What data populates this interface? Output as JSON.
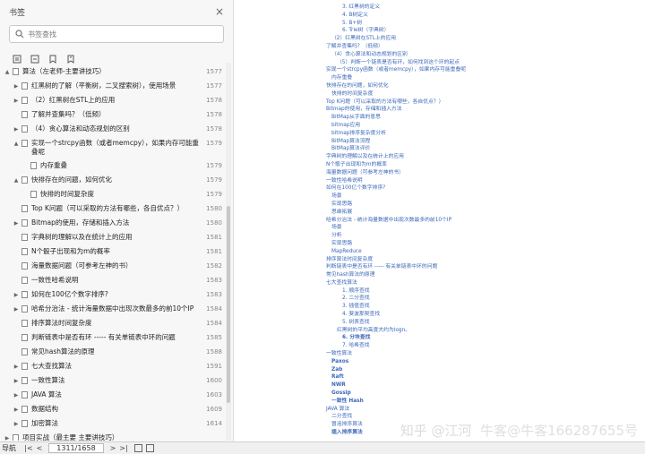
{
  "panel": {
    "title": "书签",
    "close": "×",
    "search_placeholder": "书签查找"
  },
  "bookmarks": [
    {
      "i": 0,
      "t": "▲",
      "text": "算法（左老师-主要讲技巧）",
      "page": "1577"
    },
    {
      "i": 1,
      "t": "▶",
      "text": "红黑树的了解（平衡树，二叉搜索树），使用场景",
      "page": "1577"
    },
    {
      "i": 1,
      "t": "▶",
      "text": "（2）红黑树在STL上的应用",
      "page": "1578"
    },
    {
      "i": 1,
      "t": "",
      "text": "了解并查集吗？（低频）",
      "page": "1578"
    },
    {
      "i": 1,
      "t": "▶",
      "text": "（4）贪心算法和动态规划的区别",
      "page": "1578"
    },
    {
      "i": 1,
      "t": "▲",
      "text": "实现一个strcpy函数（或者memcpy），如果内存可能重叠呢",
      "page": "1579"
    },
    {
      "i": 2,
      "t": "",
      "text": "内存重叠",
      "page": "1579"
    },
    {
      "i": 1,
      "t": "▲",
      "text": "快排存在的问题，如何优化",
      "page": "1579"
    },
    {
      "i": 2,
      "t": "",
      "text": "快排的时间复杂度",
      "page": "1579"
    },
    {
      "i": 1,
      "t": "",
      "text": "Top K问题（可以采取的方法有哪些，各自优点？）",
      "page": "1580"
    },
    {
      "i": 1,
      "t": "▶",
      "text": "Bitmap的使用，存储和插入方法",
      "page": "1580"
    },
    {
      "i": 1,
      "t": "",
      "text": "字典树的理解以及在统计上的应用",
      "page": "1581"
    },
    {
      "i": 1,
      "t": "",
      "text": "N个骰子出现和为m的概率",
      "page": "1581"
    },
    {
      "i": 1,
      "t": "",
      "text": "海量数据问题（可参考左神的书）",
      "page": "1582"
    },
    {
      "i": 1,
      "t": "",
      "text": "一致性哈希说明",
      "page": "1583"
    },
    {
      "i": 1,
      "t": "▶",
      "text": "如何在100亿个数字排序?",
      "page": "1583"
    },
    {
      "i": 1,
      "t": "▶",
      "text": "哈希分治法 - 统计海量数据中出现次数最多的前10个IP",
      "page": "1584"
    },
    {
      "i": 1,
      "t": "",
      "text": "排序算法时间复杂度",
      "page": "1584"
    },
    {
      "i": 1,
      "t": "",
      "text": "判断链表中是否有环 ----- 有关单链表中环的问题",
      "page": "1585"
    },
    {
      "i": 1,
      "t": "",
      "text": "常见hash算法的原理",
      "page": "1588"
    },
    {
      "i": 1,
      "t": "▶",
      "text": "七大查找算法",
      "page": "1591"
    },
    {
      "i": 1,
      "t": "▶",
      "text": "一致性算法",
      "page": "1600"
    },
    {
      "i": 1,
      "t": "▶",
      "text": "JAVA 算法",
      "page": "1603"
    },
    {
      "i": 1,
      "t": "▶",
      "text": "数据结构",
      "page": "1609"
    },
    {
      "i": 1,
      "t": "▶",
      "text": "加密算法",
      "page": "1614"
    },
    {
      "i": 0,
      "t": "▶",
      "text": "项目实战（最主要 主要讲技巧）",
      "page": ""
    }
  ],
  "status": {
    "label": "导航",
    "first": "|<",
    "prev": "<",
    "page": "1311/1658",
    "next": ">",
    "last": ">|"
  },
  "toc": [
    {
      "indent": 3,
      "text": "3. 红黑树的定义",
      "bold": false
    },
    {
      "indent": 3,
      "text": "4. B树定义",
      "bold": false
    },
    {
      "indent": 3,
      "text": "5. B+树",
      "bold": false
    },
    {
      "indent": 3,
      "text": "6. Trie树（字典树）",
      "bold": false
    },
    {
      "indent": 1,
      "text": "（2）红黑树在STL上的应用",
      "bold": false
    },
    {
      "indent": 0,
      "text": "了解并查集吗？（低频）",
      "bold": false
    },
    {
      "indent": 1,
      "text": "（4）贪心算法和动态规划的区别",
      "bold": false
    },
    {
      "indent": 2,
      "text": "（5）判断一个链表是否有环，如何找到这个环的起点",
      "bold": false
    },
    {
      "indent": 0,
      "text": "实现一个strcpy函数（或者memcpy），如果内存可能重叠呢",
      "bold": false
    },
    {
      "indent": 1,
      "text": "内存重叠",
      "bold": false
    },
    {
      "indent": 0,
      "text": "快排存在的问题，如何优化",
      "bold": false
    },
    {
      "indent": 1,
      "text": "快排的时间复杂度",
      "bold": false
    },
    {
      "indent": 0,
      "text": "Top K问题（可以采取的方法有哪些，各自优点？）",
      "bold": false
    },
    {
      "indent": 0,
      "text": "Bitmap的使用，存储和插入方法",
      "bold": false
    },
    {
      "indent": 1,
      "text": "BitMap从字面的意思",
      "bold": false
    },
    {
      "indent": 1,
      "text": "bitmap应用",
      "bold": false
    },
    {
      "indent": 1,
      "text": "bitmap排序复杂度分析",
      "bold": false
    },
    {
      "indent": 1,
      "text": "BitMap算法流程",
      "bold": false
    },
    {
      "indent": 1,
      "text": "BitMap算法评价",
      "bold": false
    },
    {
      "indent": 0,
      "text": "字典树的理解以及在统计上的应用",
      "bold": false
    },
    {
      "indent": 0,
      "text": "N个骰子出现和为m的概率",
      "bold": false
    },
    {
      "indent": 0,
      "text": "海量数据问题（可参考左神的书）",
      "bold": false
    },
    {
      "indent": 0,
      "text": "一致性哈希说明",
      "bold": false
    },
    {
      "indent": 0,
      "text": "如何在100亿个数字排序?",
      "bold": false
    },
    {
      "indent": 1,
      "text": "场景",
      "bold": false
    },
    {
      "indent": 1,
      "text": "实现思路",
      "bold": false
    },
    {
      "indent": 1,
      "text": "思维拓展",
      "bold": false
    },
    {
      "indent": 0,
      "text": "哈希分治法 - 统计海量数据中出现次数最多的前10个IP",
      "bold": false
    },
    {
      "indent": 1,
      "text": "场景",
      "bold": false
    },
    {
      "indent": 1,
      "text": "分析",
      "bold": false
    },
    {
      "indent": 1,
      "text": "实现思路",
      "bold": false
    },
    {
      "indent": 1,
      "text": "MapReduce",
      "bold": false
    },
    {
      "indent": 0,
      "text": "排序算法时间复杂度",
      "bold": false
    },
    {
      "indent": 0,
      "text": "判断链表中是否有环 ----- 有关单链表中环的问题",
      "bold": false
    },
    {
      "indent": 0,
      "text": "常见hash算法的原理",
      "bold": false
    },
    {
      "indent": 0,
      "text": "七大查找算法",
      "bold": false
    },
    {
      "indent": 3,
      "text": "1. 顺序查找",
      "bold": false
    },
    {
      "indent": 3,
      "text": "2. 二分查找",
      "bold": false
    },
    {
      "indent": 3,
      "text": "3. 插值查找",
      "bold": false
    },
    {
      "indent": 3,
      "text": "4. 斐波那契查找",
      "bold": false
    },
    {
      "indent": 3,
      "text": "5. 树表查找",
      "bold": false
    },
    {
      "indent": 2,
      "text": "红黑树的平均高度大约为logn。",
      "bold": false
    },
    {
      "indent": 3,
      "text": "6. 分块查找",
      "bold": true
    },
    {
      "indent": 3,
      "text": "7. 哈希查找",
      "bold": false
    },
    {
      "indent": 0,
      "text": "一致性算法",
      "bold": false
    },
    {
      "indent": 1,
      "text": "Paxos",
      "bold": true
    },
    {
      "indent": 1,
      "text": "Zab",
      "bold": true
    },
    {
      "indent": 1,
      "text": "Raft",
      "bold": true
    },
    {
      "indent": 1,
      "text": "NWR",
      "bold": true
    },
    {
      "indent": 1,
      "text": "Gossip",
      "bold": true
    },
    {
      "indent": 1,
      "text": "一致性 Hash",
      "bold": true
    },
    {
      "indent": 0,
      "text": "JAVA 算法",
      "bold": false
    },
    {
      "indent": 1,
      "text": "二分查找",
      "bold": false
    },
    {
      "indent": 1,
      "text": "冒泡排序算法",
      "bold": false
    },
    {
      "indent": 1,
      "text": "插入排序算法",
      "bold": true
    }
  ],
  "watermark": {
    "line": "知乎 @江河",
    "sub": "牛客@牛客166287655号"
  }
}
